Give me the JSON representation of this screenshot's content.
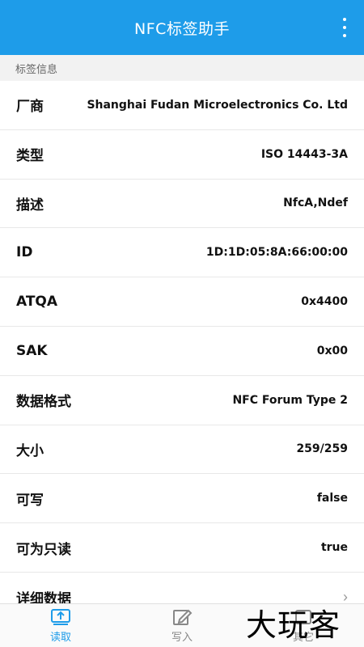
{
  "appbar": {
    "title": "NFC标签助手",
    "more_icon": "more-vert-icon"
  },
  "section": {
    "title": "标签信息"
  },
  "rows": [
    {
      "label": "厂商",
      "value": "Shanghai Fudan Microelectronics Co. Ltd"
    },
    {
      "label": "类型",
      "value": "ISO 14443-3A"
    },
    {
      "label": "描述",
      "value": "NfcA,Ndef"
    },
    {
      "label": "ID",
      "value": "1D:1D:05:8A:66:00:00"
    },
    {
      "label": "ATQA",
      "value": "0x4400"
    },
    {
      "label": "SAK",
      "value": "0x00"
    },
    {
      "label": "数据格式",
      "value": "NFC Forum Type 2"
    },
    {
      "label": "大小",
      "value": "259/259"
    },
    {
      "label": "可写",
      "value": "false"
    },
    {
      "label": "可为只读",
      "value": "true"
    }
  ],
  "detail": {
    "label": "详细数据",
    "chevron": "›"
  },
  "nav": {
    "items": [
      {
        "label": "读取",
        "icon": "read-icon"
      },
      {
        "label": "写入",
        "icon": "write-icon"
      },
      {
        "label": "其它",
        "icon": "other-icon"
      }
    ],
    "active_color": "#1e9ce9"
  },
  "watermark": {
    "text": "大玩客"
  },
  "colors": {
    "primary": "#1e9ce9"
  }
}
